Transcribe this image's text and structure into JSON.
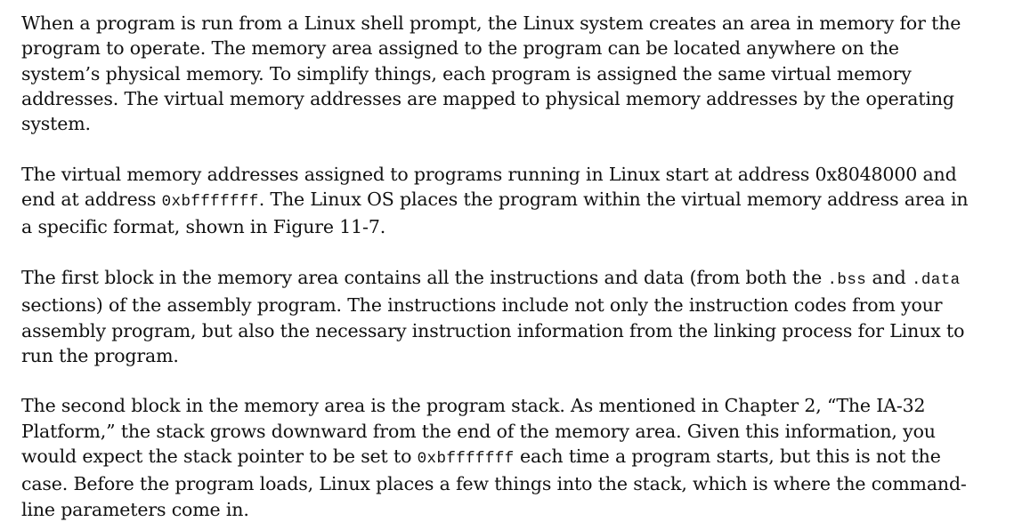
{
  "paragraphs": [
    {
      "segments": [
        {
          "text": "When a program is run from a Linux shell prompt, the Linux system creates an area in memory for the program to operate. The memory area assigned to the program can be located anywhere on the system’s physical memory. To simplify things, each program is assigned the same virtual memory addresses. The virtual memory addresses are mapped to physical memory addresses by the operating system."
        }
      ]
    },
    {
      "segments": [
        {
          "text": "The virtual memory addresses assigned to programs running in Linux start at address 0x8048000 and end at address "
        },
        {
          "text": "0xbfffffff"
        },
        {
          "text": ". The Linux OS places the program within the virtual memory address area in a specific format, shown in Figure 11-7."
        }
      ]
    },
    {
      "segments": [
        {
          "text": "The first block in the memory area contains all the instructions and data (from both the "
        },
        {
          "text": ".bss"
        },
        {
          "text": " and "
        },
        {
          "text": ".data"
        },
        {
          "text": " sections) of the assembly program. The instructions include not only the instruction codes from your assembly program, but also the necessary instruction information from the linking process for Linux to run the program."
        }
      ]
    },
    {
      "segments": [
        {
          "text": "The second block in the memory area is the program stack. As mentioned in Chapter 2, “The IA-32 Platform,” the stack grows downward from the end of the memory area. Given this information, you would expect the stack pointer to be set to "
        },
        {
          "text": "0xbfffffff"
        },
        {
          "text": " each time a program starts, but this is not the case. Before the program loads, Linux places a few things into the stack, which is where the command-line parameters come in."
        }
      ]
    }
  ]
}
